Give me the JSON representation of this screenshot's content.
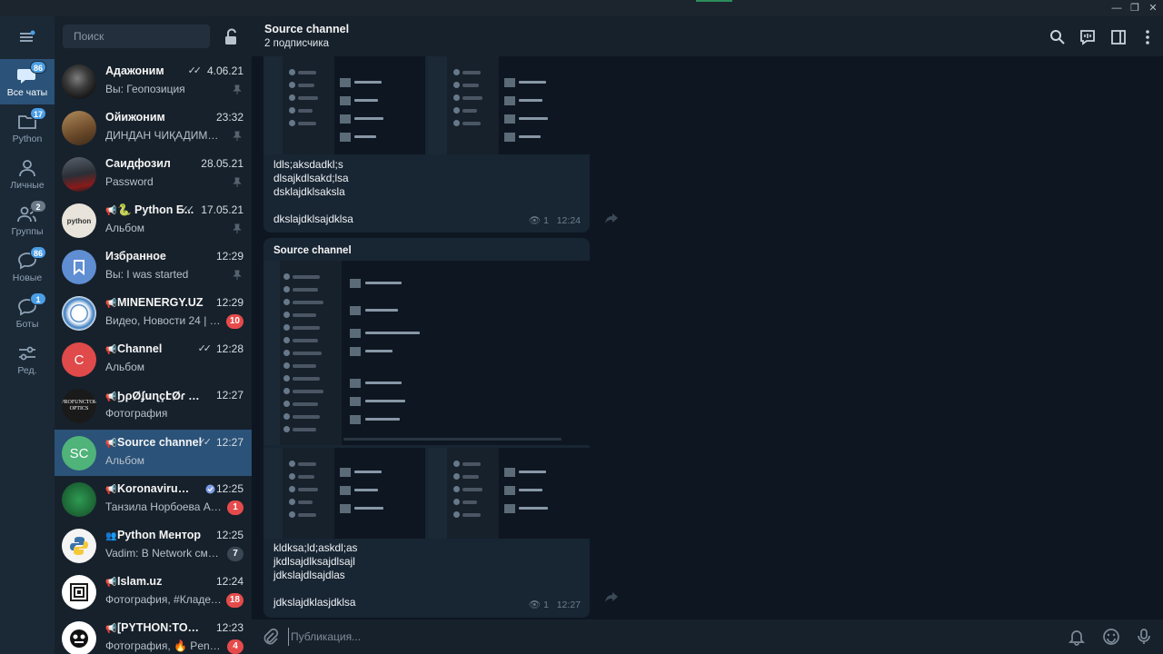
{
  "window": {
    "minimize_glyph": "—",
    "maximize_glyph": "❐",
    "close_glyph": "✕"
  },
  "folders": [
    {
      "label": "Все чаты",
      "badge": "86",
      "icon": "chats-icon",
      "active": true
    },
    {
      "label": "Python",
      "badge": "17",
      "icon": "folder-icon",
      "active": false
    },
    {
      "label": "Личные",
      "badge": "",
      "icon": "person-icon",
      "active": false
    },
    {
      "label": "Группы",
      "badge": "2",
      "icon": "group-icon",
      "active": false
    },
    {
      "label": "Новые",
      "badge": "86",
      "icon": "new-chats-icon",
      "active": false
    },
    {
      "label": "Боты",
      "badge": "1",
      "icon": "bot-icon",
      "active": false
    },
    {
      "label": "Ред.",
      "badge": "",
      "icon": "edit-filters-icon",
      "active": false
    }
  ],
  "search": {
    "placeholder": "Поиск"
  },
  "chats": [
    {
      "name": "Адажоним",
      "time": "4.06.21",
      "preview": "Вы: Геопозиция",
      "ticks": "✓✓",
      "pinned": true,
      "badge": "",
      "channel": false,
      "avatar_text": "",
      "avatar_color": "#2a2a2a"
    },
    {
      "name": "Ойижоним",
      "time": "23:32",
      "preview": "ДИНДАН ЧИҚАДИМИ ...",
      "ticks": "",
      "pinned": true,
      "badge": "",
      "channel": false,
      "avatar_text": "",
      "avatar_color": "#7a5a3a"
    },
    {
      "name": "Саидфозил",
      "time": "28.05.21",
      "preview": "Password",
      "ticks": "",
      "pinned": true,
      "badge": "",
      "channel": false,
      "avatar_text": "",
      "avatar_color": "#3a3f46"
    },
    {
      "name": "🐍 Python Б...",
      "time": "17.05.21",
      "preview": "Альбом",
      "ticks": "✓✓",
      "pinned": true,
      "badge": "",
      "channel": true,
      "avatar_text": "python",
      "avatar_color": "#e8e4dc"
    },
    {
      "name": "Избранное",
      "time": "12:29",
      "preview": "Вы: I was started",
      "ticks": "",
      "pinned": true,
      "badge": "",
      "channel": false,
      "avatar_text": "",
      "avatar_color": "#5f8ed3"
    },
    {
      "name": "MINENERGY.UZ",
      "time": "12:29",
      "preview": "Видео, Новости 24 | Э...",
      "ticks": "",
      "pinned": false,
      "badge": "10",
      "channel": true,
      "avatar_text": "",
      "avatar_color": "#ffffff"
    },
    {
      "name": "Channel",
      "time": "12:28",
      "preview": "Альбом",
      "ticks": "✓✓",
      "pinned": false,
      "badge": "",
      "channel": true,
      "avatar_text": "C",
      "avatar_color": "#e04a4a"
    },
    {
      "name": "ϦρØʄսɳçէØɾ Øπτ...",
      "time": "12:27",
      "preview": "Фотография",
      "ticks": "",
      "pinned": false,
      "badge": "",
      "channel": true,
      "avatar_text": "PROFUNCTOR OPTICS",
      "avatar_color": "#1a1a1a"
    },
    {
      "name": "Source channel",
      "time": "12:27",
      "preview": "Альбом",
      "ticks": "✓✓",
      "pinned": false,
      "badge": "",
      "channel": true,
      "avatar_text": "SC",
      "avatar_color": "#4fb37a",
      "active": true
    },
    {
      "name": "Koronavirus Inf...",
      "time": "12:25",
      "preview": "Танзила Норбоева АҚ...",
      "ticks": "",
      "pinned": false,
      "badge": "1",
      "channel": true,
      "avatar_text": "",
      "avatar_color": "#1f6e3a",
      "verified": true
    },
    {
      "name": "Python Ментор",
      "time": "12:25",
      "preview": "Vadim: В Network смотр...",
      "ticks": "",
      "pinned": false,
      "badge": "7",
      "muted": true,
      "channel": false,
      "group": true,
      "avatar_text": "",
      "avatar_color": "#f4f4f4"
    },
    {
      "name": "Islam.uz",
      "time": "12:24",
      "preview": "Фотография, #Кладезь...",
      "ticks": "",
      "pinned": false,
      "badge": "18",
      "channel": true,
      "avatar_text": "",
      "avatar_color": "#ffffff"
    },
    {
      "name": "[PYTHON:TODAY]",
      "time": "12:23",
      "preview": "Фотография, 🔥 Penetr...",
      "ticks": "",
      "pinned": false,
      "badge": "4",
      "channel": true,
      "avatar_text": "",
      "avatar_color": "#ffffff"
    }
  ],
  "conversation": {
    "title": "Source channel",
    "subtitle": "2 подписчика",
    "messages": [
      {
        "text": "ldls;aksdadkl;s\ndlsajkdlsakd;lsa\ndsklajdklsaksla\n\ndkslajdklsajdklsa",
        "views": "1",
        "time": "12:24"
      },
      {
        "sender": "Source channel",
        "text": "kldksa;ld;askdl;as\njkdlsajdlksajdlsajl\njdkslajdlsajdlas\n\njdkslajdklasjdklsa",
        "views": "1",
        "time": "12:27"
      }
    ],
    "composer_placeholder": "Публикация..."
  },
  "colors": {
    "accent": "#2b5278",
    "badge_blue": "#4a9ee5",
    "badge_red": "#e64b4b"
  }
}
